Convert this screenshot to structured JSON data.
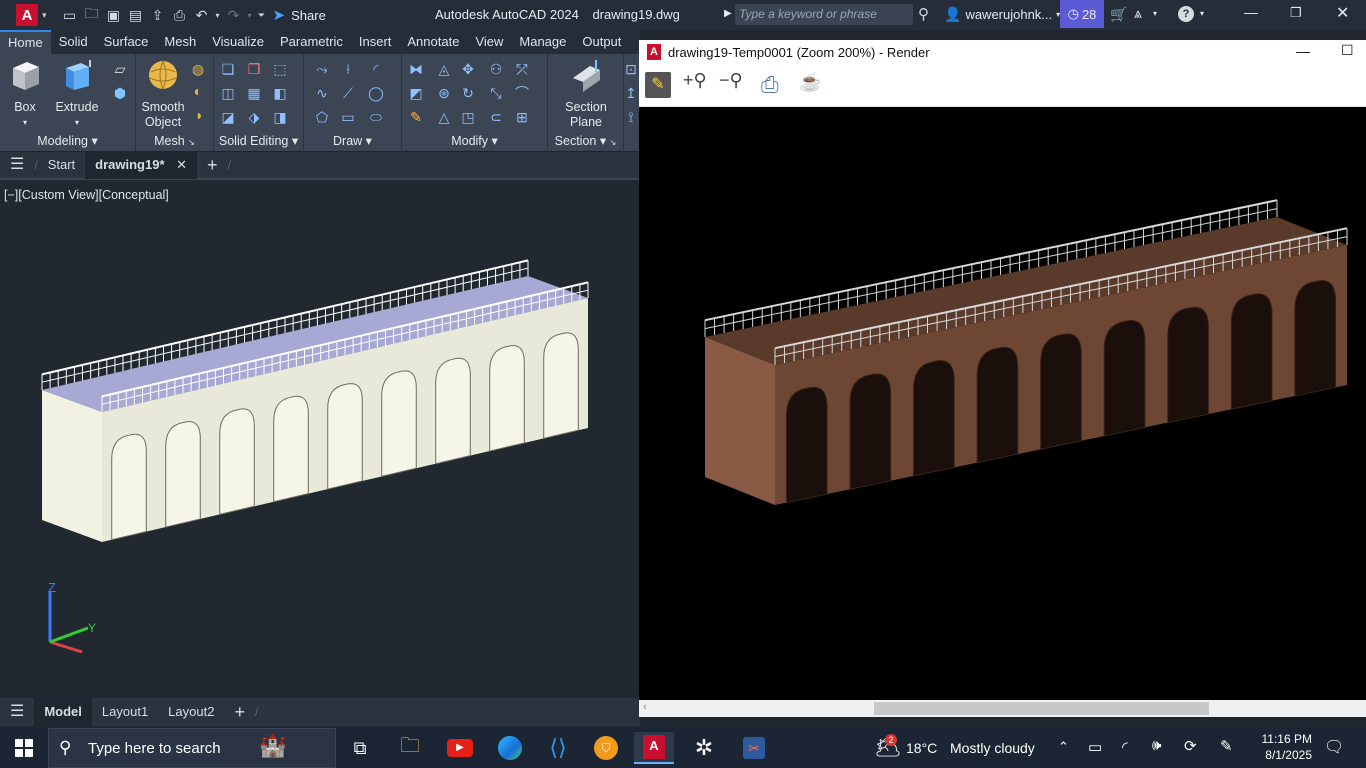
{
  "titlebar": {
    "app_letter": "A",
    "share_label": "Share",
    "app_title": "Autodesk AutoCAD 2024",
    "file_name": "drawing19.dwg",
    "search_placeholder": "Type a keyword or phrase",
    "user_name": "waweruj​ohnk...",
    "notification_count": "28"
  },
  "ribbon_tabs": [
    "Home",
    "Solid",
    "Surface",
    "Mesh",
    "Visualize",
    "Parametric",
    "Insert",
    "Annotate",
    "View",
    "Manage",
    "Output"
  ],
  "ribbon": {
    "box_label": "Box",
    "extrude_label": "Extrude",
    "smooth_label_1": "Smooth",
    "smooth_label_2": "Object",
    "section_label_1": "Section",
    "section_label_2": "Plane",
    "groups": {
      "modeling": "Modeling",
      "mesh": "Mesh",
      "solid_editing": "Solid Editing",
      "draw": "Draw",
      "modify": "Modify",
      "section": "Section"
    }
  },
  "file_tabs": {
    "start": "Start",
    "drawing": "drawing19*"
  },
  "viewport": {
    "label": "[−][Custom View][Conceptual]",
    "ucs_z": "Z",
    "ucs_y": "Y"
  },
  "layout_tabs": [
    "Model",
    "Layout1",
    "Layout2"
  ],
  "render_window": {
    "title": "drawing19-Temp0001 (Zoom 200%) - Render"
  },
  "taskbar": {
    "search_placeholder": "Type here to search",
    "weather_badge": "2",
    "weather_temp": "18°C",
    "weather_desc": "Mostly cloudy",
    "time": "11:16 PM",
    "date": "8/1/2025"
  },
  "colors": {
    "autocad_red": "#c8102e",
    "accent_blue": "#2f86e8",
    "ribbon_bg": "#3b4553",
    "viewport_bg": "#212830",
    "taskbar_bg": "#1c2533"
  }
}
